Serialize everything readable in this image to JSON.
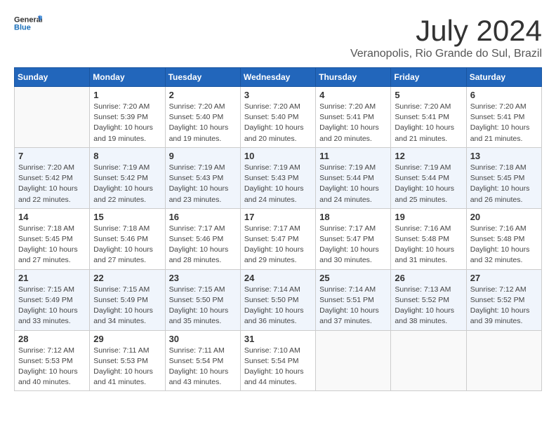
{
  "header": {
    "logo_general": "General",
    "logo_blue": "Blue",
    "month_year": "July 2024",
    "location": "Veranopolis, Rio Grande do Sul, Brazil"
  },
  "weekdays": [
    "Sunday",
    "Monday",
    "Tuesday",
    "Wednesday",
    "Thursday",
    "Friday",
    "Saturday"
  ],
  "weeks": [
    [
      {
        "day": "",
        "info": ""
      },
      {
        "day": "1",
        "info": "Sunrise: 7:20 AM\nSunset: 5:39 PM\nDaylight: 10 hours\nand 19 minutes."
      },
      {
        "day": "2",
        "info": "Sunrise: 7:20 AM\nSunset: 5:40 PM\nDaylight: 10 hours\nand 19 minutes."
      },
      {
        "day": "3",
        "info": "Sunrise: 7:20 AM\nSunset: 5:40 PM\nDaylight: 10 hours\nand 20 minutes."
      },
      {
        "day": "4",
        "info": "Sunrise: 7:20 AM\nSunset: 5:41 PM\nDaylight: 10 hours\nand 20 minutes."
      },
      {
        "day": "5",
        "info": "Sunrise: 7:20 AM\nSunset: 5:41 PM\nDaylight: 10 hours\nand 21 minutes."
      },
      {
        "day": "6",
        "info": "Sunrise: 7:20 AM\nSunset: 5:41 PM\nDaylight: 10 hours\nand 21 minutes."
      }
    ],
    [
      {
        "day": "7",
        "info": "Sunrise: 7:20 AM\nSunset: 5:42 PM\nDaylight: 10 hours\nand 22 minutes."
      },
      {
        "day": "8",
        "info": "Sunrise: 7:19 AM\nSunset: 5:42 PM\nDaylight: 10 hours\nand 22 minutes."
      },
      {
        "day": "9",
        "info": "Sunrise: 7:19 AM\nSunset: 5:43 PM\nDaylight: 10 hours\nand 23 minutes."
      },
      {
        "day": "10",
        "info": "Sunrise: 7:19 AM\nSunset: 5:43 PM\nDaylight: 10 hours\nand 24 minutes."
      },
      {
        "day": "11",
        "info": "Sunrise: 7:19 AM\nSunset: 5:44 PM\nDaylight: 10 hours\nand 24 minutes."
      },
      {
        "day": "12",
        "info": "Sunrise: 7:19 AM\nSunset: 5:44 PM\nDaylight: 10 hours\nand 25 minutes."
      },
      {
        "day": "13",
        "info": "Sunrise: 7:18 AM\nSunset: 5:45 PM\nDaylight: 10 hours\nand 26 minutes."
      }
    ],
    [
      {
        "day": "14",
        "info": "Sunrise: 7:18 AM\nSunset: 5:45 PM\nDaylight: 10 hours\nand 27 minutes."
      },
      {
        "day": "15",
        "info": "Sunrise: 7:18 AM\nSunset: 5:46 PM\nDaylight: 10 hours\nand 27 minutes."
      },
      {
        "day": "16",
        "info": "Sunrise: 7:17 AM\nSunset: 5:46 PM\nDaylight: 10 hours\nand 28 minutes."
      },
      {
        "day": "17",
        "info": "Sunrise: 7:17 AM\nSunset: 5:47 PM\nDaylight: 10 hours\nand 29 minutes."
      },
      {
        "day": "18",
        "info": "Sunrise: 7:17 AM\nSunset: 5:47 PM\nDaylight: 10 hours\nand 30 minutes."
      },
      {
        "day": "19",
        "info": "Sunrise: 7:16 AM\nSunset: 5:48 PM\nDaylight: 10 hours\nand 31 minutes."
      },
      {
        "day": "20",
        "info": "Sunrise: 7:16 AM\nSunset: 5:48 PM\nDaylight: 10 hours\nand 32 minutes."
      }
    ],
    [
      {
        "day": "21",
        "info": "Sunrise: 7:15 AM\nSunset: 5:49 PM\nDaylight: 10 hours\nand 33 minutes."
      },
      {
        "day": "22",
        "info": "Sunrise: 7:15 AM\nSunset: 5:49 PM\nDaylight: 10 hours\nand 34 minutes."
      },
      {
        "day": "23",
        "info": "Sunrise: 7:15 AM\nSunset: 5:50 PM\nDaylight: 10 hours\nand 35 minutes."
      },
      {
        "day": "24",
        "info": "Sunrise: 7:14 AM\nSunset: 5:50 PM\nDaylight: 10 hours\nand 36 minutes."
      },
      {
        "day": "25",
        "info": "Sunrise: 7:14 AM\nSunset: 5:51 PM\nDaylight: 10 hours\nand 37 minutes."
      },
      {
        "day": "26",
        "info": "Sunrise: 7:13 AM\nSunset: 5:52 PM\nDaylight: 10 hours\nand 38 minutes."
      },
      {
        "day": "27",
        "info": "Sunrise: 7:12 AM\nSunset: 5:52 PM\nDaylight: 10 hours\nand 39 minutes."
      }
    ],
    [
      {
        "day": "28",
        "info": "Sunrise: 7:12 AM\nSunset: 5:53 PM\nDaylight: 10 hours\nand 40 minutes."
      },
      {
        "day": "29",
        "info": "Sunrise: 7:11 AM\nSunset: 5:53 PM\nDaylight: 10 hours\nand 41 minutes."
      },
      {
        "day": "30",
        "info": "Sunrise: 7:11 AM\nSunset: 5:54 PM\nDaylight: 10 hours\nand 43 minutes."
      },
      {
        "day": "31",
        "info": "Sunrise: 7:10 AM\nSunset: 5:54 PM\nDaylight: 10 hours\nand 44 minutes."
      },
      {
        "day": "",
        "info": ""
      },
      {
        "day": "",
        "info": ""
      },
      {
        "day": "",
        "info": ""
      }
    ]
  ]
}
